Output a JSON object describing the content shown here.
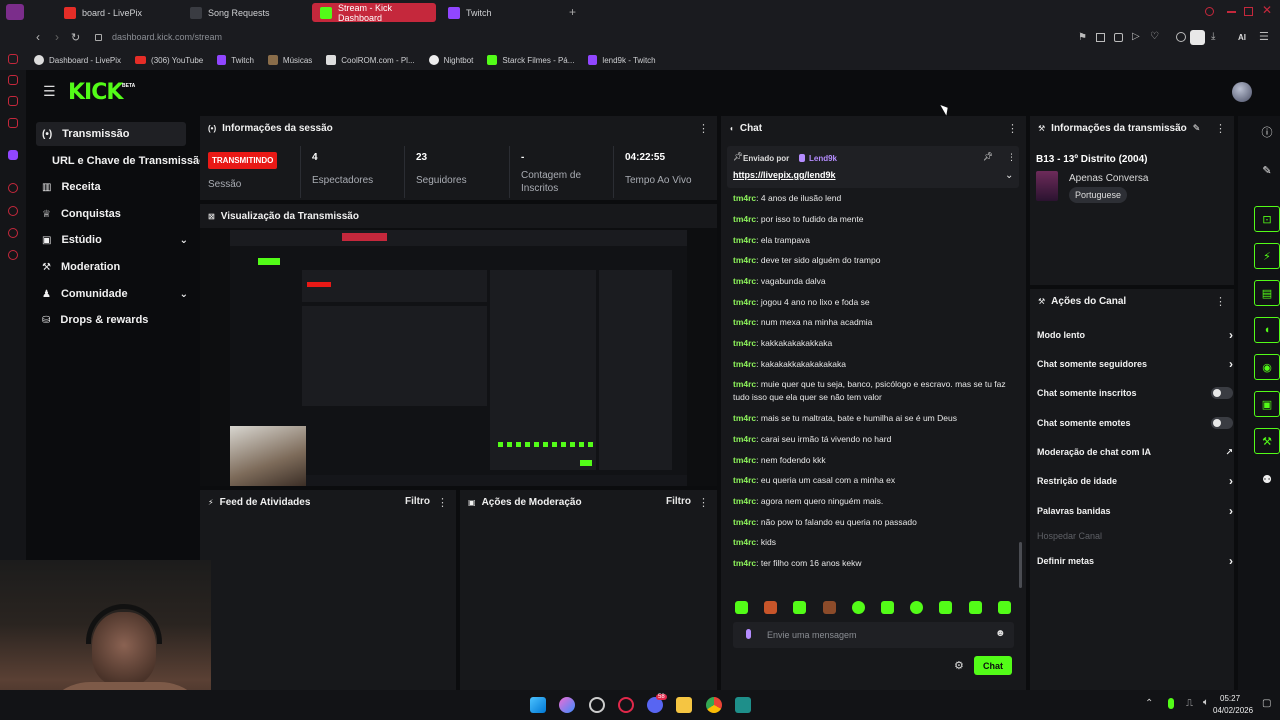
{
  "browser": {
    "tabs": [
      {
        "label": "board - LivePix"
      },
      {
        "label": "Song Requests"
      },
      {
        "label": "Stream - Kick Dashboard",
        "active": true
      },
      {
        "label": "Twitch"
      }
    ],
    "new_tab": "+",
    "url_host": "dashboard.kick.com",
    "url_path": "/stream",
    "ai_label": "AI",
    "bookmarks": [
      {
        "label": "Dashboard - LivePix"
      },
      {
        "label": "(306) YouTube"
      },
      {
        "label": "Twitch"
      },
      {
        "label": "Músicas"
      },
      {
        "label": "CoolROM.com - Pl..."
      },
      {
        "label": "Nightbot"
      },
      {
        "label": "Starck Filmes - Pá..."
      },
      {
        "label": "lend9k - Twitch"
      }
    ]
  },
  "app": {
    "logo": "KICK",
    "logo_badge": "BETA",
    "sidebar": {
      "items": [
        {
          "label": "Transmissão",
          "icon": "broadcast-icon"
        },
        {
          "label": "URL e Chave de Transmissão"
        },
        {
          "label": "Receita",
          "icon": "chart-icon"
        },
        {
          "label": "Conquistas",
          "icon": "trophy-icon"
        },
        {
          "label": "Estúdio",
          "icon": "studio-icon",
          "chevron": true
        },
        {
          "label": "Moderation",
          "icon": "wrench-icon"
        },
        {
          "label": "Comunidade",
          "icon": "community-icon",
          "chevron": true
        },
        {
          "label": "Drops & rewards",
          "icon": "drops-icon"
        }
      ]
    },
    "session": {
      "title": "Informações da sessão",
      "badge": "TRANSMITINDO",
      "badge_label": "Sessão",
      "stats": [
        {
          "value": "4",
          "label": "Espectadores"
        },
        {
          "value": "23",
          "label": "Seguidores"
        },
        {
          "value": "-",
          "label": "Contagem de Inscritos"
        },
        {
          "value": "04:22:55",
          "label": "Tempo Ao Vivo"
        }
      ]
    },
    "preview": {
      "title": "Visualização da Transmissão"
    },
    "activity": {
      "title": "Feed de Atividades",
      "filter": "Filtro"
    },
    "moderation": {
      "title": "Ações de Moderação",
      "filter": "Filtro"
    },
    "chat": {
      "title": "Chat",
      "pinned_by": "Enviado por",
      "pinned_user": "Lend9k",
      "pinned_link": "https://livepix.gg/lend9k",
      "messages": [
        {
          "user": "tm4rc",
          "text": "4 anos de ilusão lend"
        },
        {
          "user": "tm4rc",
          "text": "por isso to fudido da mente"
        },
        {
          "user": "tm4rc",
          "text": "ela trampava"
        },
        {
          "user": "tm4rc",
          "text": "deve ter sido alguém do trampo"
        },
        {
          "user": "tm4rc",
          "text": "vagabunda dalva"
        },
        {
          "user": "tm4rc",
          "text": "jogou 4 ano no lixo e foda se"
        },
        {
          "user": "tm4rc",
          "text": "num mexa na minha acadmia"
        },
        {
          "user": "tm4rc",
          "text": "kakkakakakakkaka"
        },
        {
          "user": "tm4rc",
          "text": "kakakakkakakakakaka"
        },
        {
          "user": "tm4rc",
          "text": "muie quer que tu seja, banco, psicólogo e escravo. mas se tu faz tudo isso que ela quer se não tem valor"
        },
        {
          "user": "tm4rc",
          "text": "mais se tu maltrata, bate e humilha ai se é um Deus"
        },
        {
          "user": "tm4rc",
          "text": "carai seu irmão tá vivendo no hard"
        },
        {
          "user": "tm4rc",
          "text": "nem fodendo kkk"
        },
        {
          "user": "tm4rc",
          "text": "eu queria um casal com a minha ex"
        },
        {
          "user": "tm4rc",
          "text": "agora nem quero ninguém mais."
        },
        {
          "user": "tm4rc",
          "text": "não pow to falando eu queria no passado"
        },
        {
          "user": "tm4rc",
          "text": "kids"
        },
        {
          "user": "tm4rc",
          "text": "ter filho com 16 anos kekw"
        }
      ],
      "input_placeholder": "Envie uma mensagem",
      "send_label": "Chat"
    },
    "stream_info": {
      "title": "Informações da transmissão",
      "stream_title": "B13 - 13º Distrito (2004)",
      "category": "Apenas Conversa",
      "language": "Portuguese"
    },
    "channel_actions": {
      "title": "Ações do Canal",
      "items": [
        {
          "label": "Modo lento",
          "control": "chevron"
        },
        {
          "label": "Chat somente seguidores",
          "control": "chevron"
        },
        {
          "label": "Chat somente inscritos",
          "control": "toggle"
        },
        {
          "label": "Chat somente emotes",
          "control": "toggle"
        },
        {
          "label": "Moderação de chat com IA",
          "control": "external"
        },
        {
          "label": "Restrição de idade",
          "control": "chevron"
        },
        {
          "label": "Palavras banidas",
          "control": "chevron"
        },
        {
          "label": "Hospedar Canal",
          "control": "none",
          "disabled": true
        },
        {
          "label": "Definir metas",
          "control": "chevron"
        }
      ]
    }
  },
  "taskbar": {
    "time": "05:27",
    "date": "04/02/2026",
    "discord_badge": "58"
  },
  "colors": {
    "kick_green": "#53fc18",
    "live_red": "#e91916",
    "tab_active": "#c5283c"
  }
}
